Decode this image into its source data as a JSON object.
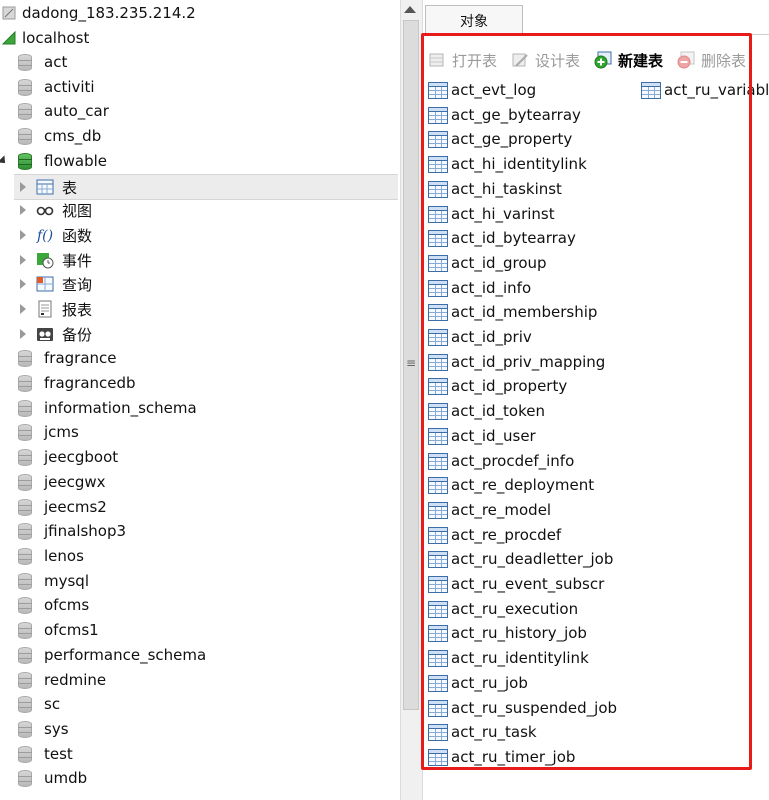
{
  "tree": {
    "server": "dadong_183.235.214.2",
    "connection": "localhost",
    "databases_before": [
      "act",
      "activiti",
      "auto_car",
      "cms_db"
    ],
    "expanded_db": "flowable",
    "expanded_children": [
      "表",
      "视图",
      "函数",
      "事件",
      "查询",
      "报表",
      "备份"
    ],
    "databases_after": [
      "fragrance",
      "fragrancedb",
      "information_schema",
      "jcms",
      "jeecgboot",
      "jeecgwx",
      "jeecms2",
      "jfinalshop3",
      "lenos",
      "mysql",
      "ofcms",
      "ofcms1",
      "performance_schema",
      "redmine",
      "sc",
      "sys",
      "test",
      "umdb"
    ]
  },
  "tab": {
    "label": "对象"
  },
  "toolbar": {
    "open_table": "打开表",
    "design_table": "设计表",
    "new_table": "新建表",
    "delete_table": "删除表"
  },
  "tables": {
    "column1": [
      "act_evt_log",
      "act_ge_bytearray",
      "act_ge_property",
      "act_hi_identitylink",
      "act_hi_taskinst",
      "act_hi_varinst",
      "act_id_bytearray",
      "act_id_group",
      "act_id_info",
      "act_id_membership",
      "act_id_priv",
      "act_id_priv_mapping",
      "act_id_property",
      "act_id_token",
      "act_id_user",
      "act_procdef_info",
      "act_re_deployment",
      "act_re_model",
      "act_re_procdef",
      "act_ru_deadletter_job",
      "act_ru_event_subscr",
      "act_ru_execution",
      "act_ru_history_job",
      "act_ru_identitylink",
      "act_ru_job",
      "act_ru_suspended_job",
      "act_ru_task",
      "act_ru_timer_job"
    ],
    "column2": [
      "act_ru_variable"
    ]
  },
  "colors": {
    "highlight": "#e81b1b",
    "table_icon": "#3b6ea8",
    "db_green": "#2f8f30"
  }
}
